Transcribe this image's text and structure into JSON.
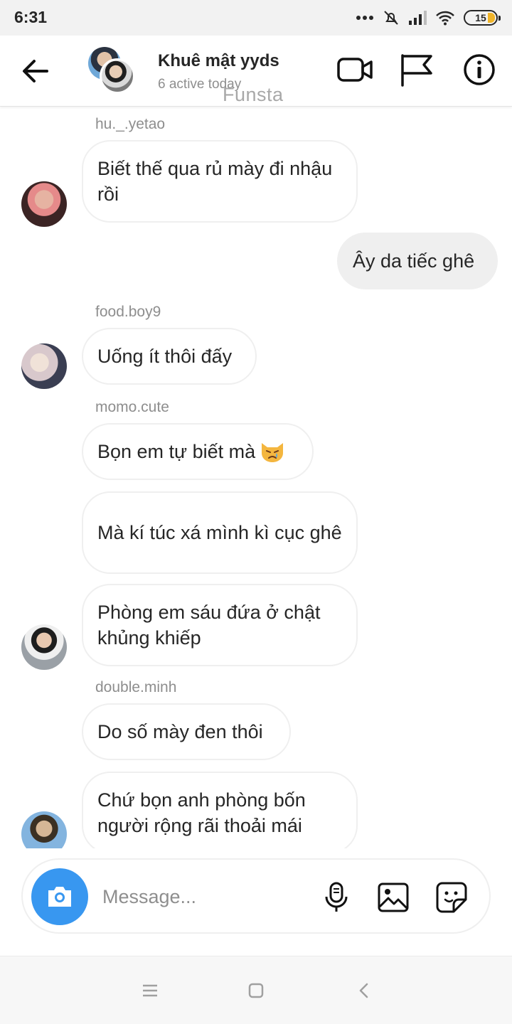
{
  "status_bar": {
    "time": "6:31",
    "battery": "15",
    "icons": [
      "more-dots-icon",
      "do-not-disturb-icon",
      "signal-icon",
      "wifi-icon",
      "battery-icon"
    ]
  },
  "header": {
    "title": "Khuê mật yyds",
    "subtitle": "6 active today",
    "watermark": "Funsta",
    "icons": [
      "back-arrow-icon",
      "video-call-icon",
      "flag-icon",
      "info-icon"
    ]
  },
  "messages": [
    {
      "sender": "hu._.yetao",
      "text": "Biết thế qua rủ mày đi nhậu rồi",
      "direction": "in"
    },
    {
      "sender": "",
      "text": "Ây da tiếc ghê",
      "direction": "out"
    },
    {
      "sender": "food.boy9",
      "text": "Uống ít thôi đấy",
      "direction": "in"
    },
    {
      "sender": "momo.cute",
      "text": "Bọn em tự biết mà",
      "emoji": "crying-cat-face-icon",
      "direction": "in"
    },
    {
      "sender": "",
      "text": "Mà kí túc xá mình kì cục ghê",
      "direction": "in"
    },
    {
      "sender": "",
      "text": "Phòng em sáu đứa ở chật khủng khiếp",
      "direction": "in"
    },
    {
      "sender": "double.minh",
      "text": "Do số mày đen thôi",
      "direction": "in"
    },
    {
      "sender": "",
      "text": "Chứ bọn anh phòng bốn người rộng rãi thoải mái",
      "direction": "in"
    }
  ],
  "composer": {
    "placeholder": "Message...",
    "icons": [
      "camera-icon",
      "microphone-icon",
      "gallery-icon",
      "sticker-icon"
    ]
  },
  "nav_bar": {
    "icons": [
      "menu-icon",
      "home-square-icon",
      "back-chevron-icon"
    ]
  },
  "colors": {
    "accent": "#3897f0",
    "bubble_border": "#efefef",
    "outgoing_bubble": "#efefef",
    "secondary_text": "#8e8e8e",
    "battery_fill": "#f0b429"
  }
}
